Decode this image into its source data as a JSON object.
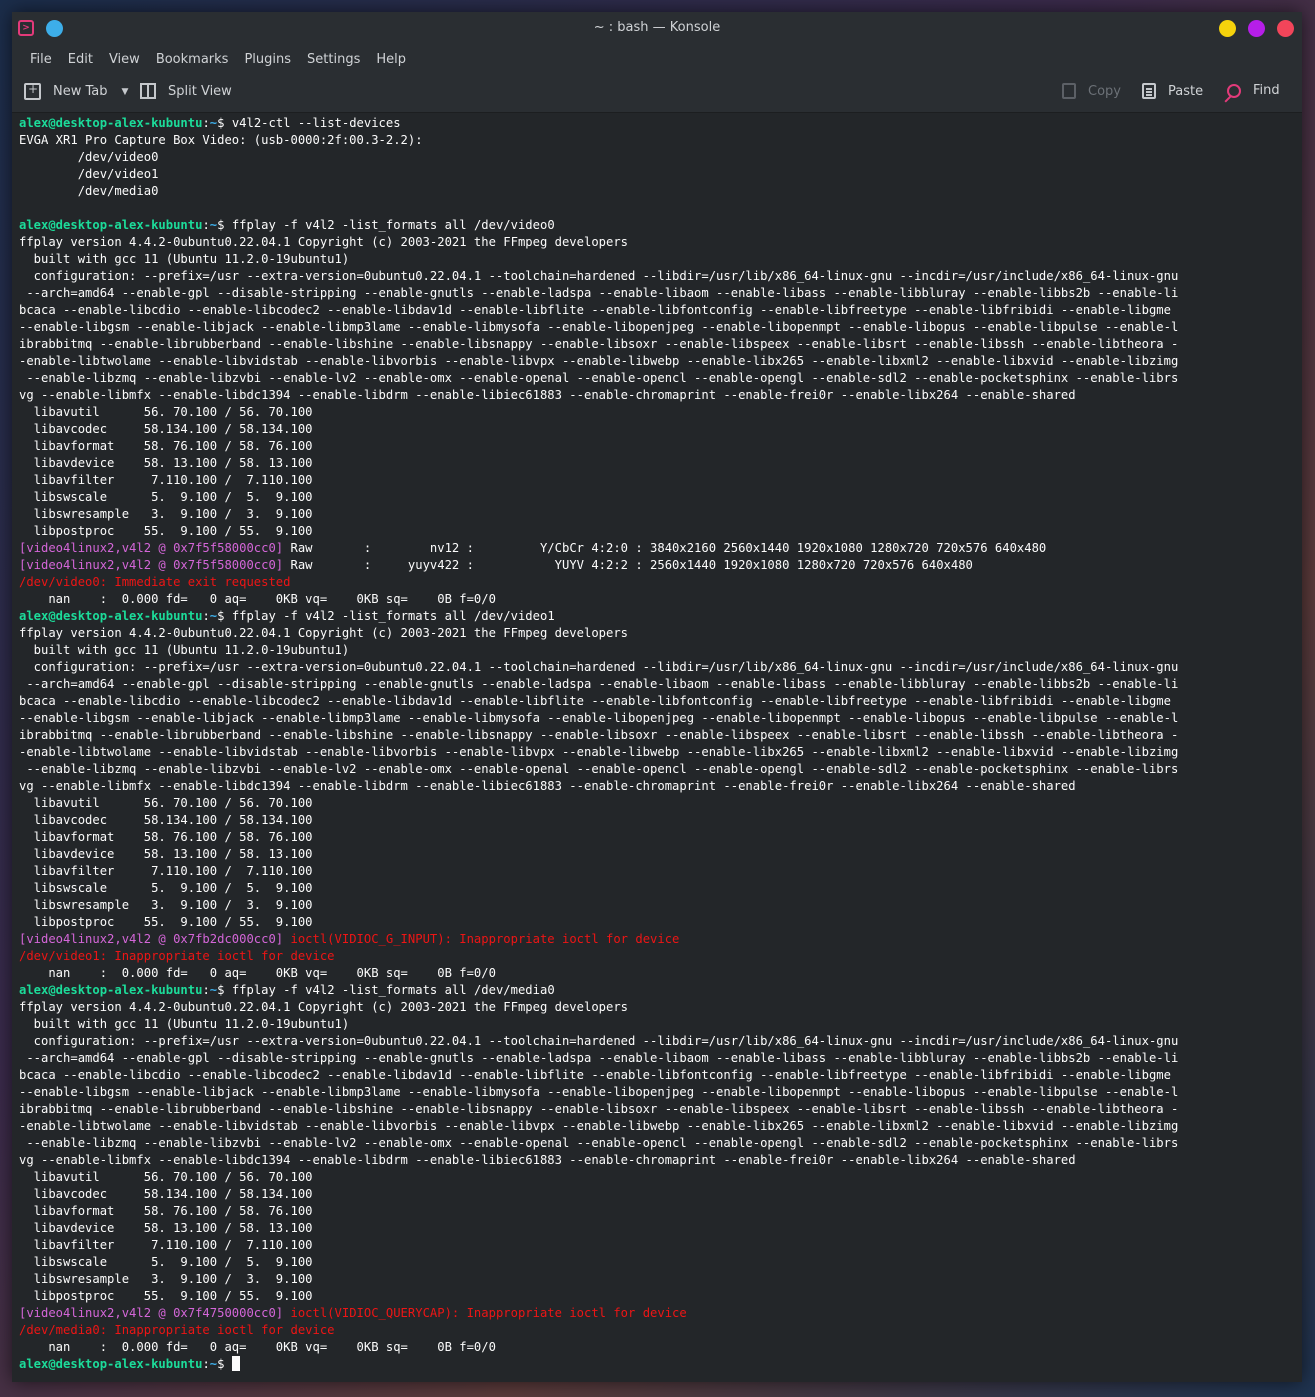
{
  "window": {
    "title": "~ : bash — Konsole"
  },
  "menu": [
    "File",
    "Edit",
    "View",
    "Bookmarks",
    "Plugins",
    "Settings",
    "Help"
  ],
  "toolbar": {
    "new_tab": "New Tab",
    "split_view": "Split View",
    "copy": "Copy",
    "paste": "Paste",
    "find": "Find"
  },
  "prompt": {
    "user": "alex@desktop-alex-kubuntu",
    "path": "~",
    "sep": ":",
    "dollar": "$ "
  },
  "colors": {
    "prompt_user": "#1cdc9a",
    "prompt_path": "#3daee9",
    "av_tag": "#d466d8",
    "error": "#ed1515"
  },
  "lines": [
    {
      "t": "p",
      "cmd": "v4l2-ctl --list-devices"
    },
    {
      "t": "o",
      "text": "EVGA XR1 Pro Capture Box Video: (usb-0000:2f:00.3-2.2):"
    },
    {
      "t": "o",
      "text": "        /dev/video0"
    },
    {
      "t": "o",
      "text": "        /dev/video1"
    },
    {
      "t": "o",
      "text": "        /dev/media0"
    },
    {
      "t": "o",
      "text": ""
    },
    {
      "t": "p",
      "cmd": "ffplay -f v4l2 -list_formats all /dev/video0"
    },
    {
      "t": "o",
      "text": "ffplay version 4.4.2-0ubuntu0.22.04.1 Copyright (c) 2003-2021 the FFmpeg developers"
    },
    {
      "t": "o",
      "text": "  built with gcc 11 (Ubuntu 11.2.0-19ubuntu1)"
    },
    {
      "t": "o",
      "text": "  configuration: --prefix=/usr --extra-version=0ubuntu0.22.04.1 --toolchain=hardened --libdir=/usr/lib/x86_64-linux-gnu --incdir=/usr/include/x86_64-linux-gnu"
    },
    {
      "t": "o",
      "text": " --arch=amd64 --enable-gpl --disable-stripping --enable-gnutls --enable-ladspa --enable-libaom --enable-libass --enable-libbluray --enable-libbs2b --enable-li"
    },
    {
      "t": "o",
      "text": "bcaca --enable-libcdio --enable-libcodec2 --enable-libdav1d --enable-libflite --enable-libfontconfig --enable-libfreetype --enable-libfribidi --enable-libgme"
    },
    {
      "t": "o",
      "text": "--enable-libgsm --enable-libjack --enable-libmp3lame --enable-libmysofa --enable-libopenjpeg --enable-libopenmpt --enable-libopus --enable-libpulse --enable-l"
    },
    {
      "t": "o",
      "text": "ibrabbitmq --enable-librubberband --enable-libshine --enable-libsnappy --enable-libsoxr --enable-libspeex --enable-libsrt --enable-libssh --enable-libtheora -"
    },
    {
      "t": "o",
      "text": "-enable-libtwolame --enable-libvidstab --enable-libvorbis --enable-libvpx --enable-libwebp --enable-libx265 --enable-libxml2 --enable-libxvid --enable-libzimg"
    },
    {
      "t": "o",
      "text": " --enable-libzmq --enable-libzvbi --enable-lv2 --enable-omx --enable-openal --enable-opencl --enable-opengl --enable-sdl2 --enable-pocketsphinx --enable-librs"
    },
    {
      "t": "o",
      "text": "vg --enable-libmfx --enable-libdc1394 --enable-libdrm --enable-libiec61883 --enable-chromaprint --enable-frei0r --enable-libx264 --enable-shared"
    },
    {
      "t": "o",
      "text": "  libavutil      56. 70.100 / 56. 70.100"
    },
    {
      "t": "o",
      "text": "  libavcodec     58.134.100 / 58.134.100"
    },
    {
      "t": "o",
      "text": "  libavformat    58. 76.100 / 58. 76.100"
    },
    {
      "t": "o",
      "text": "  libavdevice    58. 13.100 / 58. 13.100"
    },
    {
      "t": "o",
      "text": "  libavfilter     7.110.100 /  7.110.100"
    },
    {
      "t": "o",
      "text": "  libswscale      5.  9.100 /  5.  9.100"
    },
    {
      "t": "o",
      "text": "  libswresample   3.  9.100 /  3.  9.100"
    },
    {
      "t": "o",
      "text": "  libpostproc    55.  9.100 / 55.  9.100"
    },
    {
      "t": "a",
      "tag": "[video4linux2,v4l2 @ 0x7f5f58000cc0]",
      "text": " Raw       :        nv12 :         Y/CbCr 4:2:0 : 3840x2160 2560x1440 1920x1080 1280x720 720x576 640x480"
    },
    {
      "t": "a",
      "tag": "[video4linux2,v4l2 @ 0x7f5f58000cc0]",
      "text": " Raw       :     yuyv422 :           YUYV 4:2:2 : 2560x1440 1920x1080 1280x720 720x576 640x480"
    },
    {
      "t": "e",
      "text": "/dev/video0: Immediate exit requested"
    },
    {
      "t": "o",
      "text": "    nan    :  0.000 fd=   0 aq=    0KB vq=    0KB sq=    0B f=0/0"
    },
    {
      "t": "p",
      "cmd": "ffplay -f v4l2 -list_formats all /dev/video1"
    },
    {
      "t": "o",
      "text": "ffplay version 4.4.2-0ubuntu0.22.04.1 Copyright (c) 2003-2021 the FFmpeg developers"
    },
    {
      "t": "o",
      "text": "  built with gcc 11 (Ubuntu 11.2.0-19ubuntu1)"
    },
    {
      "t": "o",
      "text": "  configuration: --prefix=/usr --extra-version=0ubuntu0.22.04.1 --toolchain=hardened --libdir=/usr/lib/x86_64-linux-gnu --incdir=/usr/include/x86_64-linux-gnu"
    },
    {
      "t": "o",
      "text": " --arch=amd64 --enable-gpl --disable-stripping --enable-gnutls --enable-ladspa --enable-libaom --enable-libass --enable-libbluray --enable-libbs2b --enable-li"
    },
    {
      "t": "o",
      "text": "bcaca --enable-libcdio --enable-libcodec2 --enable-libdav1d --enable-libflite --enable-libfontconfig --enable-libfreetype --enable-libfribidi --enable-libgme"
    },
    {
      "t": "o",
      "text": "--enable-libgsm --enable-libjack --enable-libmp3lame --enable-libmysofa --enable-libopenjpeg --enable-libopenmpt --enable-libopus --enable-libpulse --enable-l"
    },
    {
      "t": "o",
      "text": "ibrabbitmq --enable-librubberband --enable-libshine --enable-libsnappy --enable-libsoxr --enable-libspeex --enable-libsrt --enable-libssh --enable-libtheora -"
    },
    {
      "t": "o",
      "text": "-enable-libtwolame --enable-libvidstab --enable-libvorbis --enable-libvpx --enable-libwebp --enable-libx265 --enable-libxml2 --enable-libxvid --enable-libzimg"
    },
    {
      "t": "o",
      "text": " --enable-libzmq --enable-libzvbi --enable-lv2 --enable-omx --enable-openal --enable-opencl --enable-opengl --enable-sdl2 --enable-pocketsphinx --enable-librs"
    },
    {
      "t": "o",
      "text": "vg --enable-libmfx --enable-libdc1394 --enable-libdrm --enable-libiec61883 --enable-chromaprint --enable-frei0r --enable-libx264 --enable-shared"
    },
    {
      "t": "o",
      "text": "  libavutil      56. 70.100 / 56. 70.100"
    },
    {
      "t": "o",
      "text": "  libavcodec     58.134.100 / 58.134.100"
    },
    {
      "t": "o",
      "text": "  libavformat    58. 76.100 / 58. 76.100"
    },
    {
      "t": "o",
      "text": "  libavdevice    58. 13.100 / 58. 13.100"
    },
    {
      "t": "o",
      "text": "  libavfilter     7.110.100 /  7.110.100"
    },
    {
      "t": "o",
      "text": "  libswscale      5.  9.100 /  5.  9.100"
    },
    {
      "t": "o",
      "text": "  libswresample   3.  9.100 /  3.  9.100"
    },
    {
      "t": "o",
      "text": "  libpostproc    55.  9.100 / 55.  9.100"
    },
    {
      "t": "a",
      "tag": "[video4linux2,v4l2 @ 0x7fb2dc000cc0]",
      "text": " ",
      "errtext": "ioctl(VIDIOC_G_INPUT): Inappropriate ioctl for device"
    },
    {
      "t": "e",
      "text": "/dev/video1: Inappropriate ioctl for device"
    },
    {
      "t": "o",
      "text": "    nan    :  0.000 fd=   0 aq=    0KB vq=    0KB sq=    0B f=0/0"
    },
    {
      "t": "p",
      "cmd": "ffplay -f v4l2 -list_formats all /dev/media0"
    },
    {
      "t": "o",
      "text": "ffplay version 4.4.2-0ubuntu0.22.04.1 Copyright (c) 2003-2021 the FFmpeg developers"
    },
    {
      "t": "o",
      "text": "  built with gcc 11 (Ubuntu 11.2.0-19ubuntu1)"
    },
    {
      "t": "o",
      "text": "  configuration: --prefix=/usr --extra-version=0ubuntu0.22.04.1 --toolchain=hardened --libdir=/usr/lib/x86_64-linux-gnu --incdir=/usr/include/x86_64-linux-gnu"
    },
    {
      "t": "o",
      "text": " --arch=amd64 --enable-gpl --disable-stripping --enable-gnutls --enable-ladspa --enable-libaom --enable-libass --enable-libbluray --enable-libbs2b --enable-li"
    },
    {
      "t": "o",
      "text": "bcaca --enable-libcdio --enable-libcodec2 --enable-libdav1d --enable-libflite --enable-libfontconfig --enable-libfreetype --enable-libfribidi --enable-libgme"
    },
    {
      "t": "o",
      "text": "--enable-libgsm --enable-libjack --enable-libmp3lame --enable-libmysofa --enable-libopenjpeg --enable-libopenmpt --enable-libopus --enable-libpulse --enable-l"
    },
    {
      "t": "o",
      "text": "ibrabbitmq --enable-librubberband --enable-libshine --enable-libsnappy --enable-libsoxr --enable-libspeex --enable-libsrt --enable-libssh --enable-libtheora -"
    },
    {
      "t": "o",
      "text": "-enable-libtwolame --enable-libvidstab --enable-libvorbis --enable-libvpx --enable-libwebp --enable-libx265 --enable-libxml2 --enable-libxvid --enable-libzimg"
    },
    {
      "t": "o",
      "text": " --enable-libzmq --enable-libzvbi --enable-lv2 --enable-omx --enable-openal --enable-opencl --enable-opengl --enable-sdl2 --enable-pocketsphinx --enable-librs"
    },
    {
      "t": "o",
      "text": "vg --enable-libmfx --enable-libdc1394 --enable-libdrm --enable-libiec61883 --enable-chromaprint --enable-frei0r --enable-libx264 --enable-shared"
    },
    {
      "t": "o",
      "text": "  libavutil      56. 70.100 / 56. 70.100"
    },
    {
      "t": "o",
      "text": "  libavcodec     58.134.100 / 58.134.100"
    },
    {
      "t": "o",
      "text": "  libavformat    58. 76.100 / 58. 76.100"
    },
    {
      "t": "o",
      "text": "  libavdevice    58. 13.100 / 58. 13.100"
    },
    {
      "t": "o",
      "text": "  libavfilter     7.110.100 /  7.110.100"
    },
    {
      "t": "o",
      "text": "  libswscale      5.  9.100 /  5.  9.100"
    },
    {
      "t": "o",
      "text": "  libswresample   3.  9.100 /  3.  9.100"
    },
    {
      "t": "o",
      "text": "  libpostproc    55.  9.100 / 55.  9.100"
    },
    {
      "t": "a",
      "tag": "[video4linux2,v4l2 @ 0x7f4750000cc0]",
      "text": " ",
      "errtext": "ioctl(VIDIOC_QUERYCAP): Inappropriate ioctl for device"
    },
    {
      "t": "e",
      "text": "/dev/media0: Inappropriate ioctl for device"
    },
    {
      "t": "o",
      "text": "    nan    :  0.000 fd=   0 aq=    0KB vq=    0KB sq=    0B f=0/0"
    },
    {
      "t": "c"
    }
  ]
}
